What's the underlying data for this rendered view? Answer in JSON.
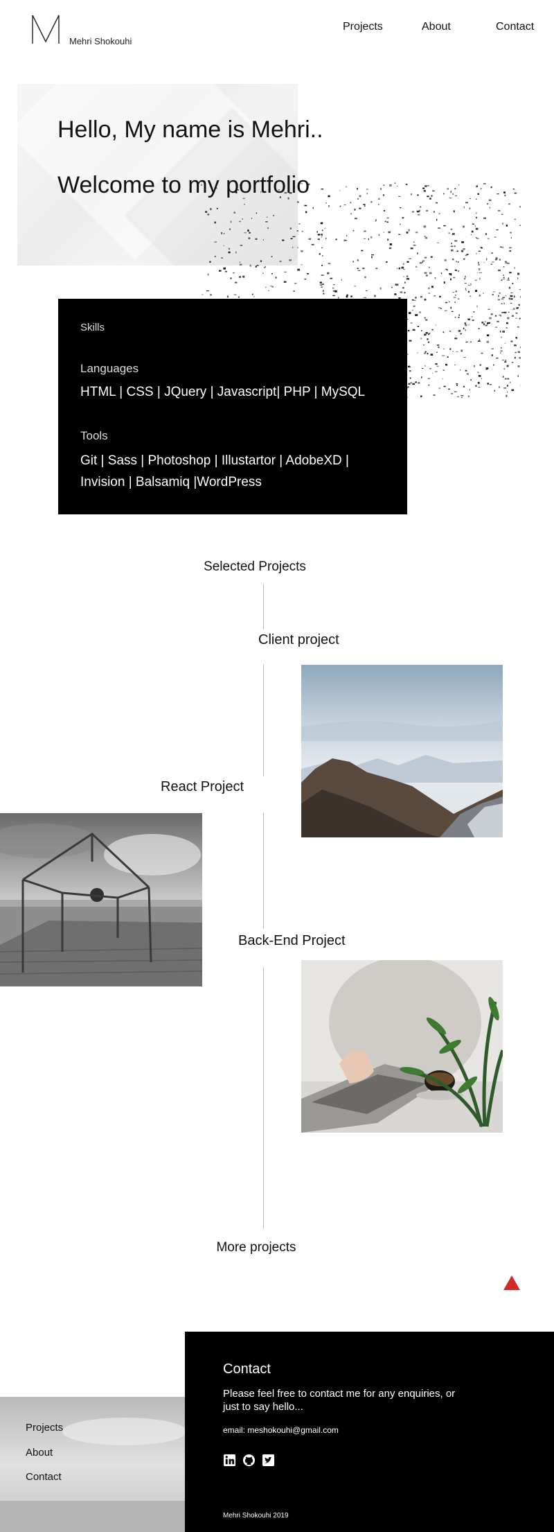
{
  "header": {
    "logo_letter": "M",
    "name": "Mehri Shokouhi",
    "nav": [
      "Projects",
      "About",
      "Contact"
    ]
  },
  "hero": {
    "line1": "Hello, My name is Mehri..",
    "line2": "Welcome to my portfolio"
  },
  "skills": {
    "title": "Skills",
    "languages_heading": "Languages",
    "languages": "HTML | CSS | JQuery | Javascript| PHP | MySQL",
    "tools_heading": "Tools",
    "tools": "Git | Sass | Photoshop | Illustartor | AdobeXD | Invision | Balsamiq |WordPress"
  },
  "projects": {
    "section_title": "Selected Projects",
    "items": [
      {
        "title": "Client project",
        "image": "misty-mountains"
      },
      {
        "title": "React Project",
        "image": "frame-on-pier"
      },
      {
        "title": "Back-End Project",
        "image": "laptop-and-coffee"
      }
    ],
    "more": "More projects"
  },
  "footer": {
    "nav": [
      "Projects",
      "About",
      "Contact"
    ],
    "contact_title": "Contact",
    "contact_text": "Please feel free to contact me for  any enquiries, or just to say hello...",
    "email": "email: meshokouhi@gmail.com",
    "social_icons": [
      "linkedin-icon",
      "github-icon",
      "twitter-icon"
    ],
    "copyright": "Mehri Shokouhi 2019"
  },
  "colors": {
    "accent": "#d22a2a",
    "dark": "#000000",
    "text": "#111111"
  }
}
